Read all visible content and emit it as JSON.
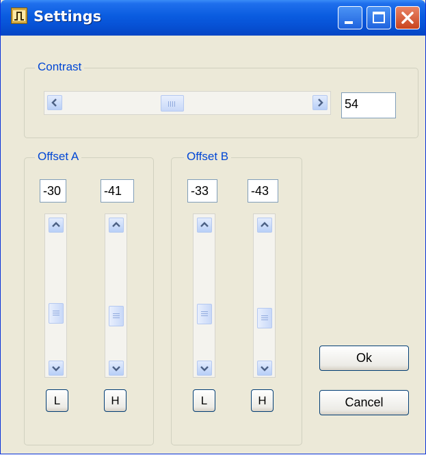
{
  "window": {
    "title": "Settings"
  },
  "contrast": {
    "label": "Contrast",
    "value": "54"
  },
  "offset_a": {
    "label": "Offset A",
    "low_value": "-30",
    "high_value": "-41",
    "low_button": "L",
    "high_button": "H"
  },
  "offset_b": {
    "label": "Offset B",
    "low_value": "-33",
    "high_value": "-43",
    "low_button": "L",
    "high_button": "H"
  },
  "buttons": {
    "ok": "Ok",
    "cancel": "Cancel"
  },
  "icons": [
    "app-icon",
    "minimize-icon",
    "maximize-icon",
    "close-icon",
    "arrow-left-icon",
    "arrow-right-icon",
    "arrow-up-icon",
    "arrow-down-icon",
    "grip-icon"
  ]
}
